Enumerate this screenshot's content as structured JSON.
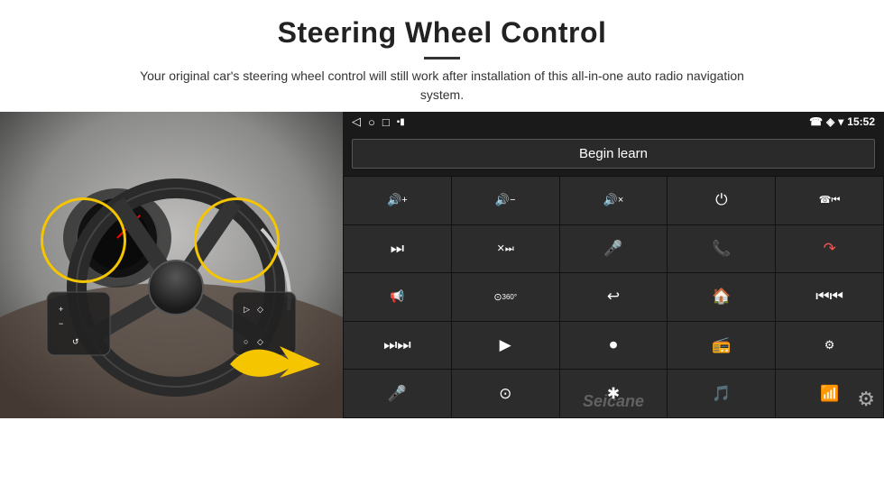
{
  "header": {
    "title": "Steering Wheel Control",
    "description": "Your original car's steering wheel control will still work after installation of this all-in-one auto radio navigation system."
  },
  "status_bar": {
    "nav_back": "◁",
    "nav_home_circle": "○",
    "nav_square": "□",
    "battery_icon": "▪▪",
    "phone_icon": "☏",
    "location_icon": "◈",
    "wifi_icon": "▾",
    "time": "15:52"
  },
  "begin_learn": {
    "label": "Begin learn"
  },
  "watermark": "Seicane",
  "controls": [
    {
      "icon": "🔊+",
      "label": "vol up"
    },
    {
      "icon": "🔊−",
      "label": "vol down"
    },
    {
      "icon": "🔇",
      "label": "mute"
    },
    {
      "icon": "⏻",
      "label": "power"
    },
    {
      "icon": "📞⏮",
      "label": "call prev"
    },
    {
      "icon": "⏭",
      "label": "next track"
    },
    {
      "icon": "⏪⏭",
      "label": "seek"
    },
    {
      "icon": "🎤",
      "label": "mic"
    },
    {
      "icon": "📞",
      "label": "call"
    },
    {
      "icon": "📵",
      "label": "end call"
    },
    {
      "icon": "📣",
      "label": "audio src"
    },
    {
      "icon": "360°",
      "label": "360 cam"
    },
    {
      "icon": "↩",
      "label": "back"
    },
    {
      "icon": "🏠",
      "label": "home"
    },
    {
      "icon": "⏮⏮",
      "label": "prev"
    },
    {
      "icon": "⏭⏭",
      "label": "fast fwd"
    },
    {
      "icon": "▶",
      "label": "nav"
    },
    {
      "icon": "⏺",
      "label": "media"
    },
    {
      "icon": "📻",
      "label": "radio"
    },
    {
      "icon": "⚙",
      "label": "eq"
    },
    {
      "icon": "🎤",
      "label": "mic2"
    },
    {
      "icon": "⊙",
      "label": "cam"
    },
    {
      "icon": "✱",
      "label": "bt"
    },
    {
      "icon": "🎵",
      "label": "music"
    },
    {
      "icon": "📶",
      "label": "signal"
    }
  ]
}
